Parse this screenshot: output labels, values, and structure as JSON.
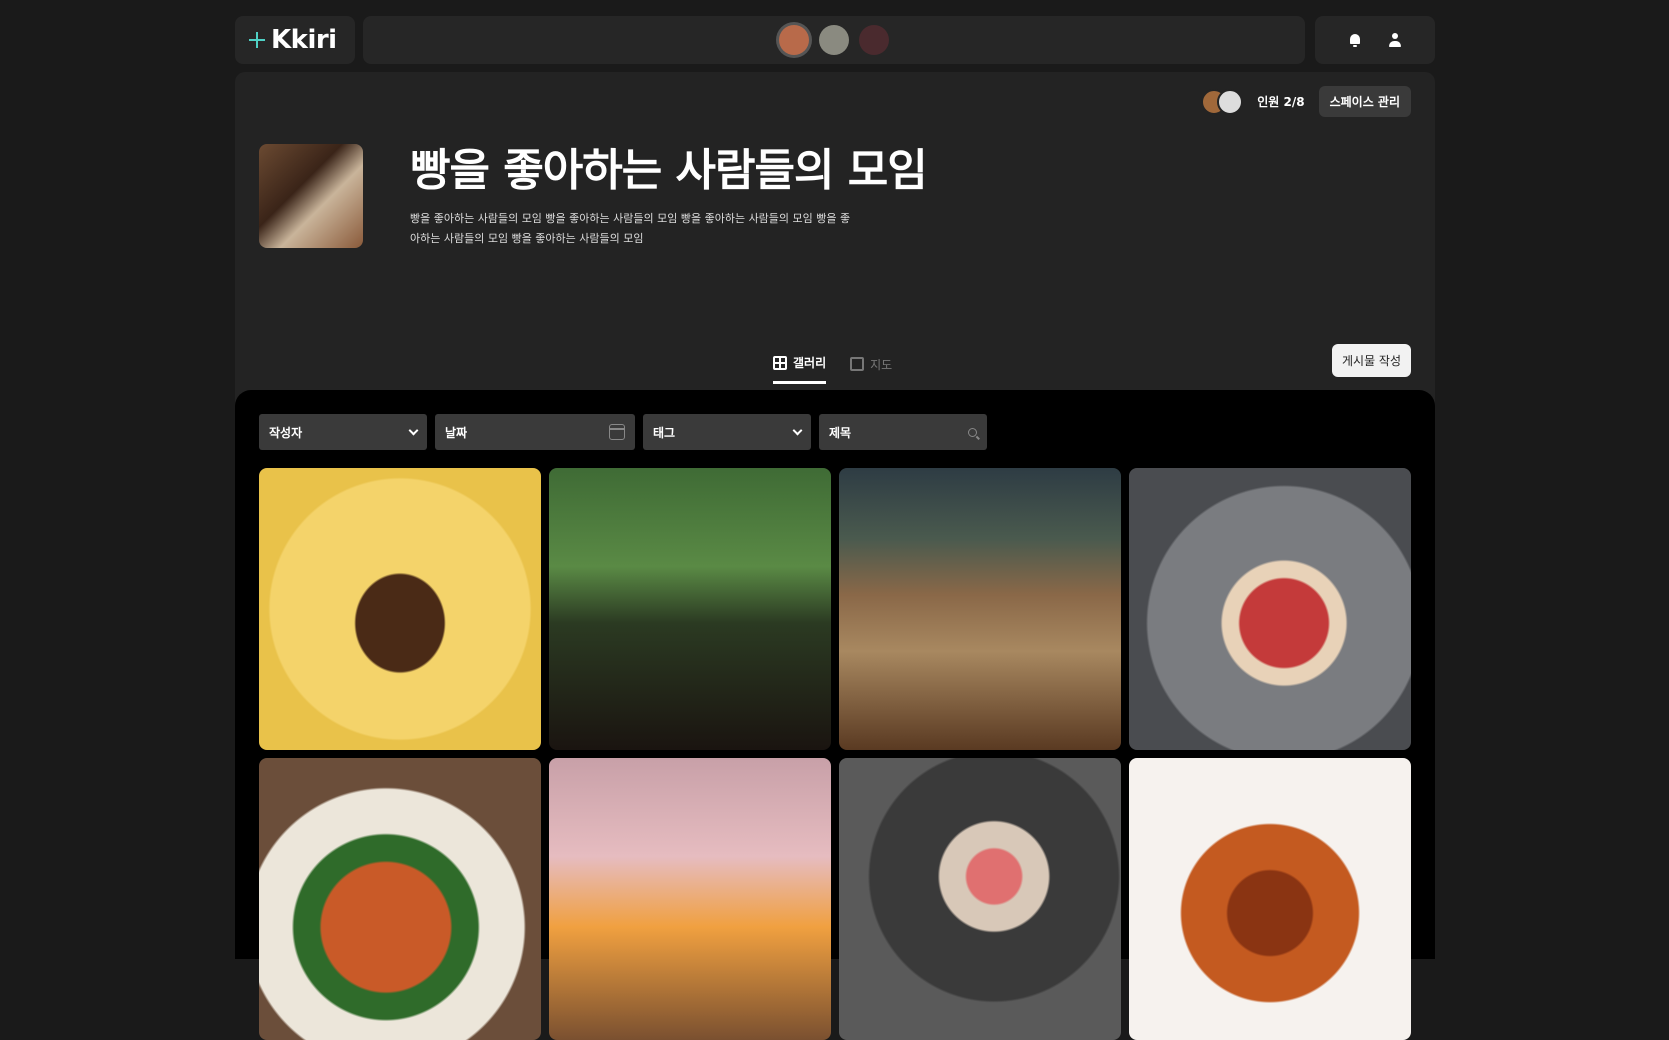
{
  "app": {
    "logo_text": "Kkiri"
  },
  "header": {
    "spaces": [
      {
        "name": "space-avatar-1",
        "color": "#b86a4a",
        "active": true
      },
      {
        "name": "space-avatar-2",
        "color": "#8a8a80",
        "active": false
      },
      {
        "name": "space-avatar-3",
        "color": "#4a2a2e",
        "active": false
      }
    ],
    "icons": [
      "bell-icon",
      "user-icon"
    ]
  },
  "space": {
    "members_label": "인원 2/8",
    "manage_label": "스페이스 관리",
    "title": "빵을 좋아하는 사람들의 모임",
    "description": "빵을 좋아하는 사람들의 모임 빵을 좋아하는 사람들의 모임 빵을 좋아하는 사람들의 모임 빵을 좋아하는 사람들의 모임 빵을 좋아하는 사람들의 모임",
    "write_label": "게시물 작성"
  },
  "tabs": {
    "gallery": "갤러리",
    "map": "지도"
  },
  "filters": {
    "author": "작성자",
    "date": "날짜",
    "tag": "태그",
    "title": "제목"
  },
  "gallery": {
    "rows_visible": 2,
    "columns": 4,
    "tiles": 8
  }
}
